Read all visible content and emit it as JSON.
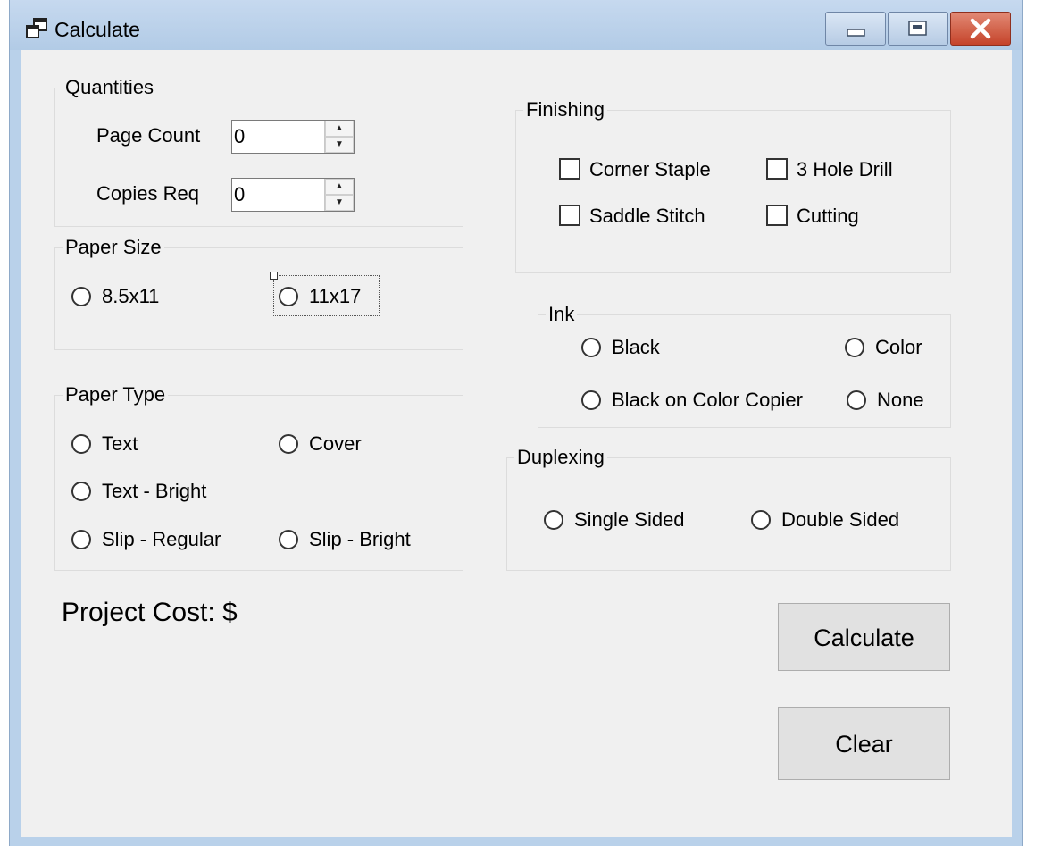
{
  "window": {
    "title": "Calculate"
  },
  "quantities": {
    "title": "Quantities",
    "page_count_label": "Page Count",
    "page_count_value": "0",
    "copies_label": "Copies Req",
    "copies_value": "0"
  },
  "paper_size": {
    "title": "Paper Size",
    "options": [
      "8.5x11",
      "11x17"
    ]
  },
  "paper_type": {
    "title": "Paper Type",
    "options": [
      "Text",
      "Cover",
      "Text - Bright",
      "Slip - Regular",
      "Slip - Bright"
    ]
  },
  "finishing": {
    "title": "Finishing",
    "options": [
      "Corner Staple",
      "3 Hole Drill",
      "Saddle Stitch",
      "Cutting"
    ]
  },
  "ink": {
    "title": "Ink",
    "options": [
      "Black",
      "Color",
      "Black on Color Copier",
      "None"
    ]
  },
  "duplexing": {
    "title": "Duplexing",
    "options": [
      "Single Sided",
      "Double Sided"
    ]
  },
  "cost": {
    "label": "Project Cost: $"
  },
  "buttons": {
    "calculate": "Calculate",
    "clear": "Clear"
  },
  "icons": {
    "app": "app-window-icon",
    "minimize": "minimize-icon",
    "maximize": "maximize-icon",
    "close": "close-icon",
    "spin_up": "spin-up-arrow-icon",
    "spin_down": "spin-down-arrow-icon"
  },
  "colors": {
    "titlebar": "#b9d1ea",
    "close": "#c5432a",
    "client": "#f0f0f0"
  }
}
